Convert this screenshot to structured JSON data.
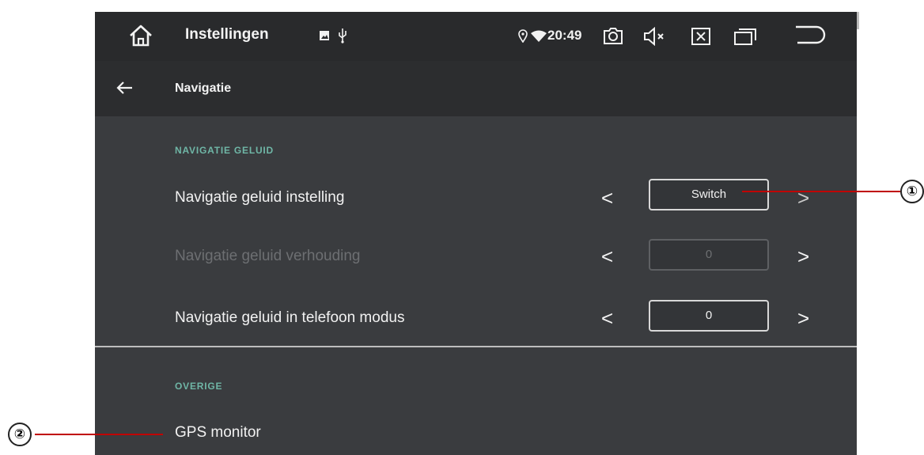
{
  "statusbar": {
    "title": "Instellingen",
    "time": "20:49"
  },
  "toolbar": {
    "title": "Navigatie"
  },
  "sections": [
    {
      "header": "NAVIGATIE GELUID",
      "rows": [
        {
          "label": "Navigatie geluid instelling",
          "value": "Switch",
          "enabled": true
        },
        {
          "label": "Navigatie geluid verhouding",
          "value": "0",
          "enabled": false
        },
        {
          "label": "Navigatie geluid in telefoon modus",
          "value": "0",
          "enabled": true
        }
      ]
    },
    {
      "header": "OVERIGE",
      "rows": [
        {
          "label": "GPS monitor"
        }
      ]
    }
  ],
  "callouts": [
    "①",
    "②"
  ],
  "icons": {
    "statusbar": [
      "home-icon",
      "image-icon",
      "usb-icon",
      "location-icon",
      "wifi-icon",
      "camera-icon",
      "volume-mute-icon",
      "close-box-icon",
      "recent-apps-icon",
      "back-arrow-icon"
    ],
    "toolbar": [
      "arrow-left-icon"
    ],
    "rows": [
      "chevron-left-icon",
      "chevron-right-icon"
    ]
  },
  "colors": {
    "statusbar_bg": "#292a2c",
    "toolbar_bg": "#2c2d2f",
    "content_bg": "#3a3c3f",
    "section_header": "#6fb6a6",
    "callout_line": "#c00000"
  }
}
